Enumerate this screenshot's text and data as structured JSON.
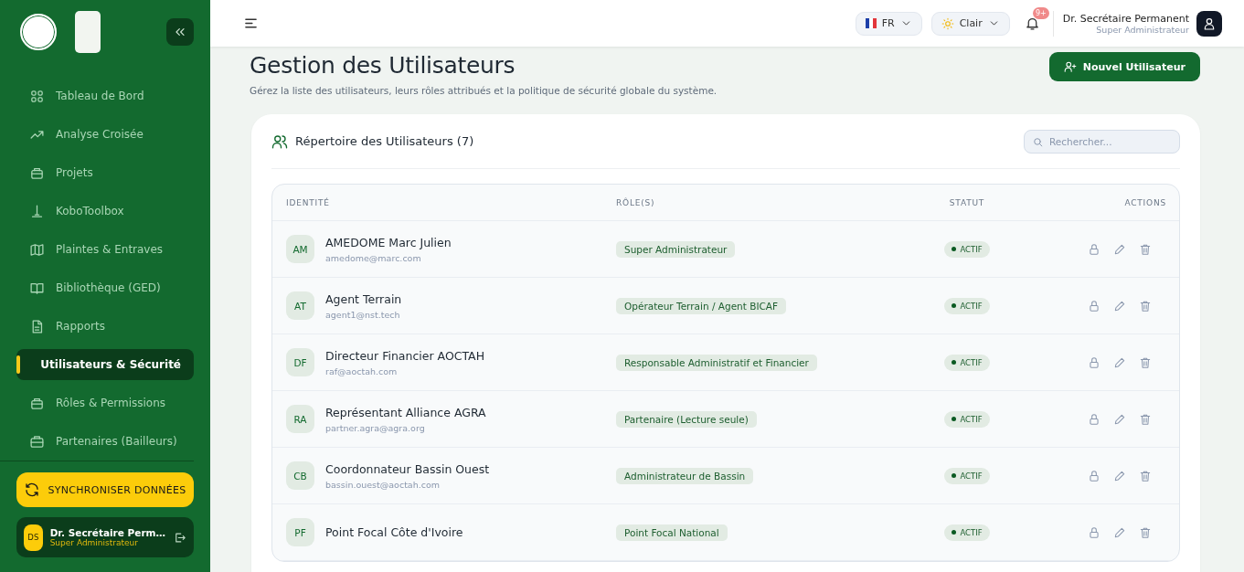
{
  "sidebar": {
    "nav": [
      {
        "label": "Tableau de Bord",
        "selected": false
      },
      {
        "label": "Analyse Croisée",
        "selected": false
      },
      {
        "label": "Projets",
        "selected": false
      },
      {
        "label": "KoboToolbox",
        "selected": false
      },
      {
        "label": "Plaintes & Entraves",
        "selected": false
      },
      {
        "label": "Bibliothèque (GED)",
        "selected": false
      },
      {
        "label": "Rapports",
        "selected": false
      },
      {
        "label": "Utilisateurs & Sécurité",
        "selected": true
      },
      {
        "label": "Rôles & Permissions",
        "selected": false
      },
      {
        "label": "Partenaires (Bailleurs)",
        "selected": false
      }
    ],
    "sync_button": "SYNCHRONISER DONNÉES",
    "user": {
      "initials": "DS",
      "name": "Dr. Secrétaire Perm…",
      "role": "Super Administrateur"
    }
  },
  "header": {
    "language": "FR",
    "theme": "Clair",
    "notifications": "9+",
    "user_name": "Dr. Secrétaire Permanent",
    "user_role": "Super Administrateur"
  },
  "page": {
    "title": "Gestion des Utilisateurs",
    "subtitle": "Gérez la liste des utilisateurs, leurs rôles attribués et la politique de sécurité globale du système.",
    "new_button": "Nouvel Utilisateur"
  },
  "directory": {
    "title": "Répertoire des Utilisateurs (7)",
    "search": {
      "placeholder": "Rechercher..."
    },
    "columns": [
      "IDENTITÉ",
      "RÔLE(S)",
      "STATUT",
      "ACTIONS"
    ],
    "rows": [
      {
        "initials": "AM",
        "name": "AMEDOME Marc Julien",
        "email": "amedome@marc.com",
        "role": "Super Administrateur",
        "status": "ACTIF"
      },
      {
        "initials": "AT",
        "name": "Agent Terrain",
        "email": "agent1@nst.tech",
        "role": "Opérateur Terrain / Agent BICAF",
        "status": "ACTIF"
      },
      {
        "initials": "DF",
        "name": "Directeur Financier AOCTAH",
        "email": "raf@aoctah.com",
        "role": "Responsable Administratif et Financier",
        "status": "ACTIF"
      },
      {
        "initials": "RA",
        "name": "Représentant Alliance AGRA",
        "email": "partner.agra@agra.org",
        "role": "Partenaire (Lecture seule)",
        "status": "ACTIF"
      },
      {
        "initials": "CB",
        "name": "Coordonnateur Bassin Ouest",
        "email": "bassin.ouest@aoctah.com",
        "role": "Administrateur de Bassin",
        "status": "ACTIF"
      },
      {
        "initials": "PF",
        "name": "Point Focal Côte d'Ivoire",
        "role": "Point Focal National",
        "status": "ACTIF"
      }
    ]
  }
}
